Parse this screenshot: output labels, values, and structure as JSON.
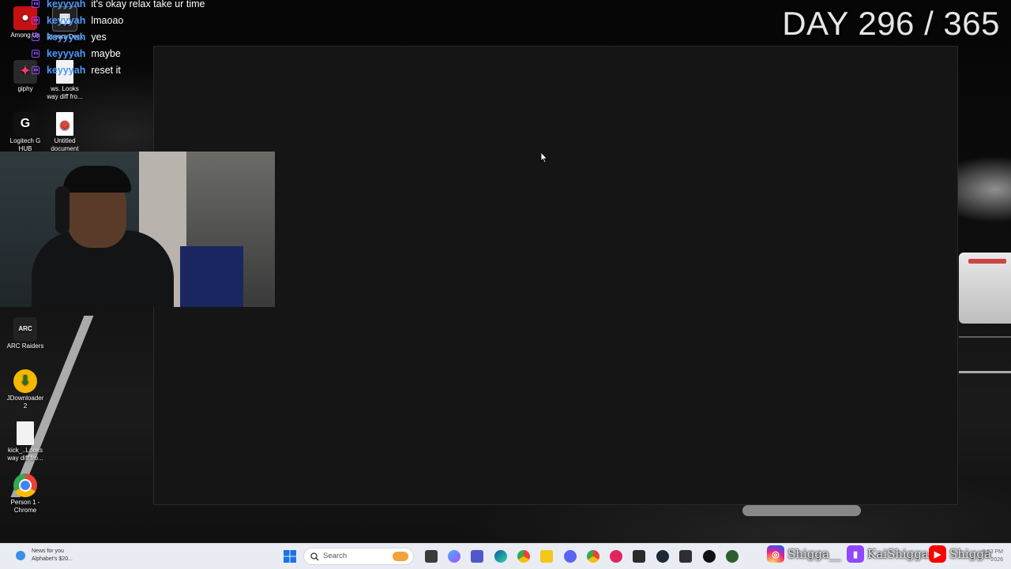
{
  "overlay": {
    "day_counter": "DAY 296 / 365",
    "chat": [
      {
        "user": "keyyyah",
        "message": "it's okay relax take ur time"
      },
      {
        "user": "keyyyah",
        "message": "lmaoao"
      },
      {
        "user": "keyyyah",
        "message": "yes"
      },
      {
        "user": "keyyyah",
        "message": "maybe"
      },
      {
        "user": "keyyyah",
        "message": "reset it"
      }
    ],
    "socials": [
      {
        "platform": "instagram-icon",
        "handle": "Shigga__",
        "color": "#d6249f"
      },
      {
        "platform": "twitch-icon",
        "handle": "KaiShigga",
        "color": "#9146ff"
      },
      {
        "platform": "youtube-icon",
        "handle": "Shigga",
        "color": "#ff0000"
      }
    ]
  },
  "desktop_icons": [
    {
      "label": "Among Us",
      "icon": "among-us-icon",
      "color": "#c51111"
    },
    {
      "label": "Stream Deck",
      "icon": "stream-deck-icon",
      "color": "#222"
    },
    {
      "label": "giphy",
      "icon": "giphy-icon",
      "color": "#2a2a2a"
    },
    {
      "label": "ws. Looks way diff fro...",
      "icon": "file-icon",
      "color": "#f2f2f2"
    },
    {
      "label": "Logitech G HUB",
      "icon": "logitech-icon",
      "color": "#111"
    },
    {
      "label": "Untitled document",
      "icon": "google-docs-icon",
      "color": "#ffffff"
    },
    {
      "label": "ARC Raiders",
      "icon": "arc-raiders-icon",
      "color": "#222"
    },
    {
      "label": "JDownloader 2",
      "icon": "jdownloader-icon",
      "color": "#f5b800"
    },
    {
      "label": "kick_..Looks way diff fro...",
      "icon": "file-icon",
      "color": "#f2f2f2"
    },
    {
      "label": "Person 1 - Chrome",
      "icon": "chrome-icon",
      "color": "#4285f4"
    }
  ],
  "taskbar": {
    "news_line1": "News for you",
    "news_line2": "Alphabet's $20...",
    "search_placeholder": "Search",
    "clock_time": "8:53 PM",
    "clock_date": "2026"
  }
}
